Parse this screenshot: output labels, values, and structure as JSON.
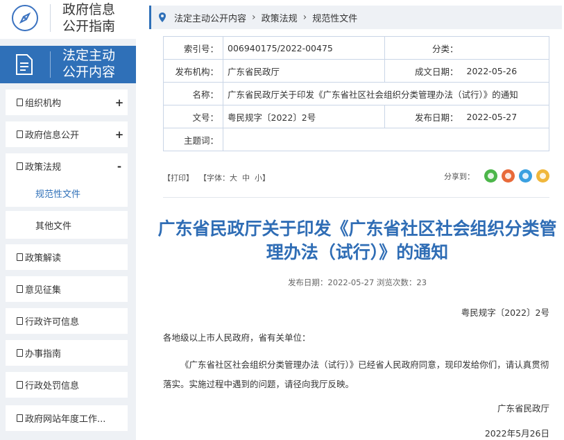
{
  "sidebar": {
    "guide_line1": "政府信息",
    "guide_line2": "公开指南",
    "section_line1": "法定主动",
    "section_line2": "公开内容",
    "items": [
      {
        "label": "组织机构",
        "toggle": "+"
      },
      {
        "label": "政府信息公开",
        "toggle": "+"
      },
      {
        "label": "政策法规",
        "toggle": "-"
      },
      {
        "label": "规范性文件"
      },
      {
        "label": "其他文件"
      },
      {
        "label": "政策解读"
      },
      {
        "label": "意见征集"
      },
      {
        "label": "行政许可信息"
      },
      {
        "label": "办事指南"
      },
      {
        "label": "行政处罚信息"
      },
      {
        "label": "政府网站年度工作..."
      }
    ]
  },
  "breadcrumb": {
    "items": [
      "法定主动公开内容",
      "政策法规",
      "规范性文件"
    ],
    "separator": "›"
  },
  "info": {
    "index_label": "索引号：",
    "index_value": "006940175/2022-00475",
    "category_label": "分类：",
    "category_value": "",
    "issuer_label": "发布机构：",
    "issuer_value": "广东省民政厅",
    "created_label": "成文日期：",
    "created_value": "2022-05-26",
    "name_label": "名称：",
    "name_value": "广东省民政厅关于印发《广东省社区社会组织分类管理办法（试行）》的通知",
    "docno_label": "文号：",
    "docno_value": "粤民规字〔2022〕2号",
    "published_label": "发布日期：",
    "published_value": "2022-05-27",
    "subject_label": "主题词：",
    "subject_value": ""
  },
  "tools": {
    "print": "【打印】",
    "font_label": "【字体：",
    "font_large": "大",
    "font_mid": "中",
    "font_small": "小",
    "font_close": "】",
    "share": "分享到："
  },
  "share_icons": [
    "wechat-icon",
    "weibo-icon",
    "qq-icon",
    "qzone-icon"
  ],
  "colors": {
    "accent": "#2f70b8",
    "title": "#2f6db5",
    "wechat": "#4cb64a",
    "weibo": "#e86a3a",
    "qq": "#3aa0e0",
    "qzone": "#f0b73c"
  },
  "article": {
    "title": "广东省民政厅关于印发《广东省社区社会组织分类管理办法（试行）》的通知",
    "meta": "发布日期：2022-05-27  浏览次数：23",
    "docnum": "粤民规字〔2022〕2号",
    "greeting": "各地级以上市人民政府，省有关单位：",
    "paragraph": "《广东省社区社会组织分类管理办法（试行）》已经省人民政府同意，现印发给你们，请认真贯彻落实。实施过程中遇到的问题，请径向我厅反映。",
    "org": "广东省民政厅",
    "date": "2022年5月26日"
  }
}
